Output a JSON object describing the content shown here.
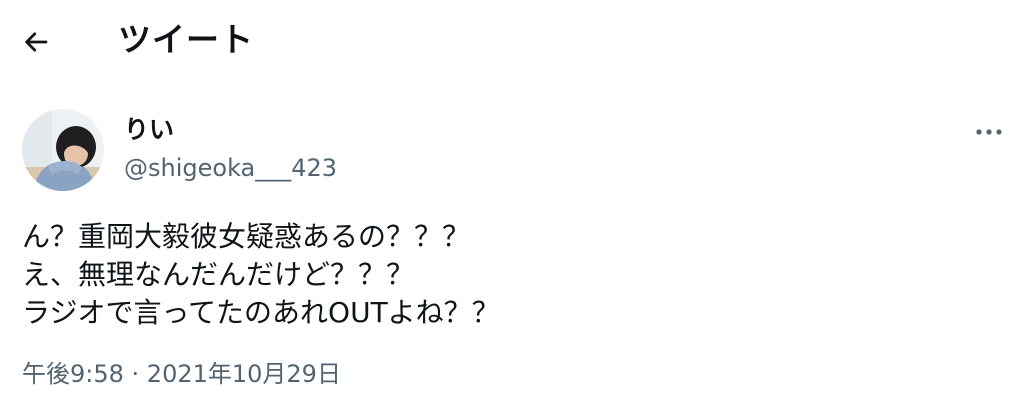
{
  "header": {
    "back_icon": "arrow-left-icon",
    "title": "ツイート"
  },
  "tweet": {
    "author": {
      "display_name": "りい",
      "handle": "@shigeoka___423",
      "avatar_icon": "user-avatar"
    },
    "more_icon": "more-horizontal-icon",
    "lines": [
      "ん？重岡大毅彼女疑惑あるの？？？",
      "え、無理なんだんだけど？？？",
      "ラジオで言ってたのあれOUTよね？？"
    ],
    "time": "午後9:58",
    "separator": " · ",
    "date": "2021年10月29日"
  },
  "colors": {
    "text_primary": "#0f1419",
    "text_secondary": "#536471",
    "background": "#ffffff"
  }
}
